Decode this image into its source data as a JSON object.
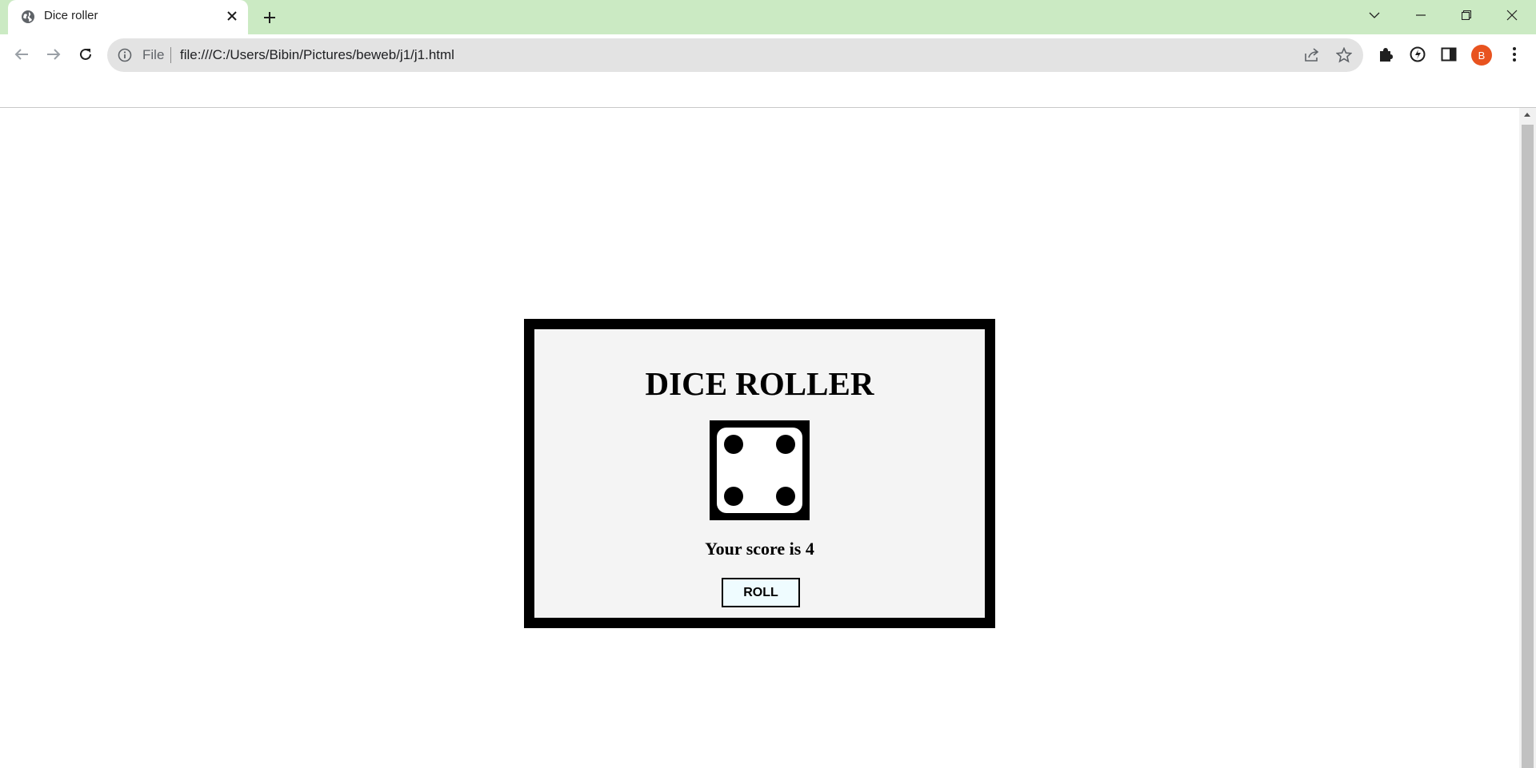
{
  "browser": {
    "tab": {
      "title": "Dice roller",
      "favicon": "globe-icon",
      "close_icon": "close-icon"
    },
    "new_tab_icon": "plus-icon",
    "window_controls": [
      "chevron-down-icon",
      "minimize-icon",
      "restore-icon",
      "close-icon"
    ],
    "address_bar": {
      "scheme_label": "File",
      "url": "file:///C:/Users/Bibin/Pictures/beweb/j1/j1.html"
    },
    "avatar_letter": "B",
    "colors": {
      "tabstrip": "#cbeac3",
      "omnibox": "#e3e3e3",
      "avatar": "#e8531f"
    }
  },
  "page": {
    "title": "DICE ROLLER",
    "die_value": 4,
    "score_text": "Your score is 4",
    "roll_button_label": "ROLL",
    "colors": {
      "card_background": "#f4f4f4",
      "card_border": "#000000",
      "button_background": "#effcff"
    }
  }
}
